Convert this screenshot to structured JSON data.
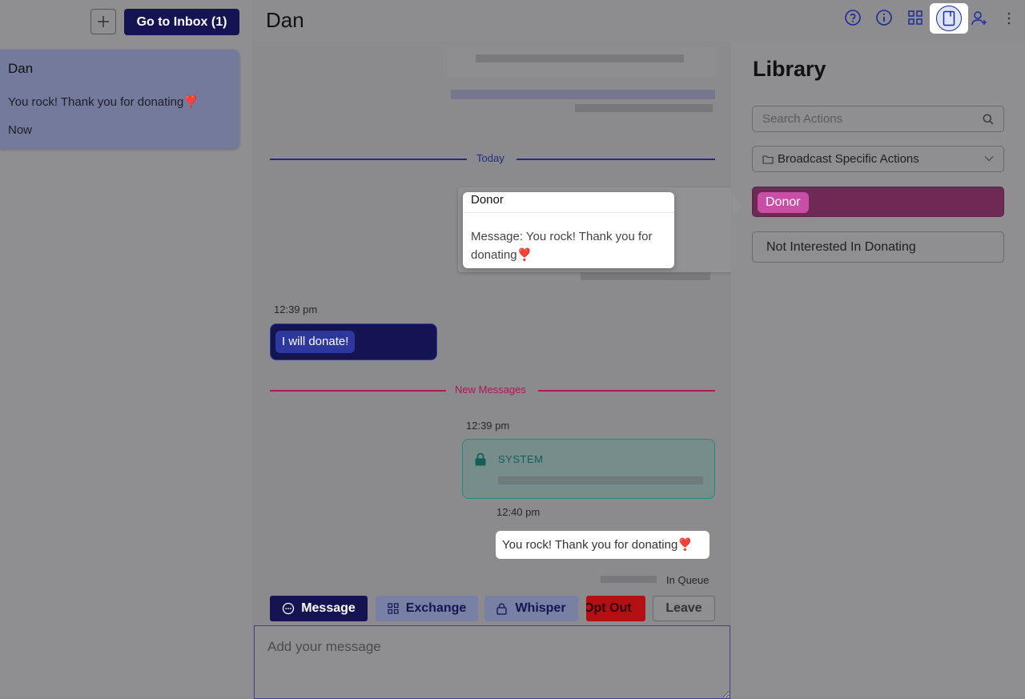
{
  "left_panel": {
    "new_button_label": "+",
    "inbox_button_label": "Go to Inbox (1)",
    "conversation": {
      "name": "Dan",
      "preview": "You rock! Thank you for donating❣️",
      "time": "Now"
    }
  },
  "header": {
    "title": "Dan",
    "icons": [
      "help-icon",
      "info-icon",
      "grid-icon",
      "library-book-icon",
      "add-user-icon",
      "more-vertical-icon"
    ]
  },
  "chat": {
    "divider_today": "Today",
    "tooltip": {
      "title": "Donor",
      "body": "Message: You rock! Thank you for donating❣️"
    },
    "incoming": {
      "time": "12:39 pm",
      "text": "I will donate!"
    },
    "divider_new": "New Messages",
    "system": {
      "time": "12:39 pm",
      "label": "SYSTEM"
    },
    "outgoing": {
      "time": "12:40 pm",
      "text": "You rock! Thank you for donating❣️",
      "status": "In Queue"
    },
    "actions": {
      "message": "Message",
      "exchange": "Exchange",
      "whisper": "Whisper",
      "opt_out": "Opt Out",
      "leave": "Leave"
    },
    "composer_placeholder": "Add your message"
  },
  "library": {
    "title": "Library",
    "search_placeholder": "Search Actions",
    "dropdown_label": "Broadcast Specific Actions",
    "items": [
      {
        "label": "Donor"
      },
      {
        "label": "Not Interested In Donating"
      }
    ]
  },
  "colors": {
    "navy": "#141452",
    "accent_blue": "#1b2a9c",
    "new_messages": "#b0155a",
    "system_teal": "#1f8a80",
    "opt_out_red": "#b40f13",
    "donor_pink": "#c84ea6"
  }
}
